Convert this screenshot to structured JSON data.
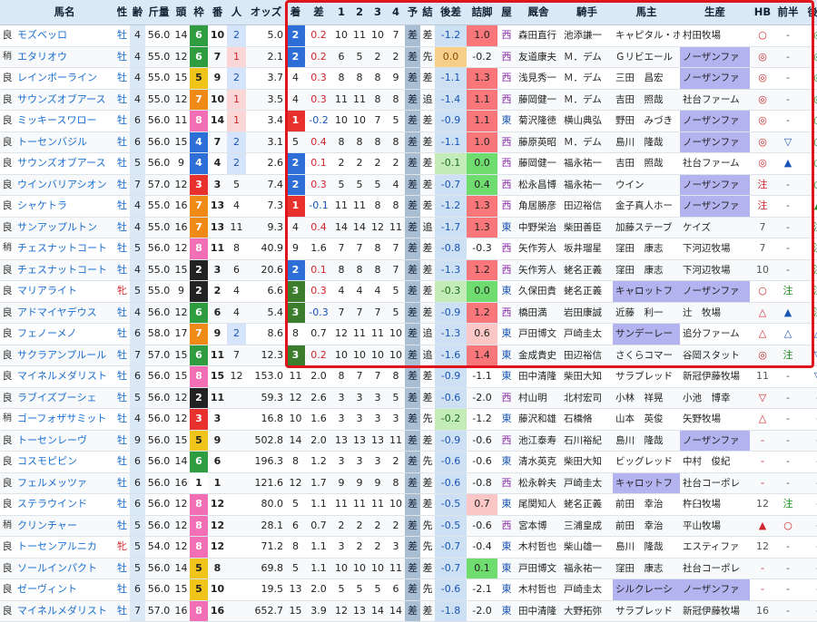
{
  "headers": [
    "",
    "馬名",
    "性",
    "齢",
    "斤量",
    "頭",
    "枠",
    "番",
    "人",
    "オッズ",
    "着",
    "差",
    "1",
    "2",
    "3",
    "4",
    "予",
    "結",
    "後差",
    "詰脚",
    "屋",
    "厩舎",
    "騎手",
    "馬主",
    "生産",
    "HB",
    "前半",
    "後半"
  ],
  "rows": [
    {
      "baba": "良",
      "name": "モズベッロ",
      "sex": "牡",
      "age": "4",
      "kin": "56.0",
      "tou": "14",
      "waku": "6",
      "uma": "10",
      "pop": "2",
      "odds": "5.0",
      "chaku": "2",
      "sa": "0.2",
      "c1": "10",
      "c2": "11",
      "c3": "10",
      "c4": "7",
      "yoso": "差",
      "kekka": "差",
      "kousa": "-1.2",
      "tsume": "1.0",
      "ya": "西",
      "kyusha": "森田直行",
      "kishu": "池添謙一",
      "owner": "キャピタル・ホ",
      "breed": "村田牧場",
      "hb": "○",
      "zen": "-",
      "kou": "◎"
    },
    {
      "baba": "稍",
      "name": "エタリオウ",
      "sex": "牡",
      "age": "4",
      "kin": "55.0",
      "tou": "12",
      "waku": "6",
      "uma": "7",
      "pop": "1",
      "odds": "2.1",
      "chaku": "2",
      "sa": "0.2",
      "c1": "6",
      "c2": "5",
      "c3": "2",
      "c4": "2",
      "yoso": "差",
      "kekka": "先",
      "kousa": "0.0",
      "tsume": "-0.2",
      "ya": "西",
      "kyusha": "友道康夫",
      "kishu": "Ｍ．デム",
      "owner": "Ｇリビエール",
      "breed": "ノーザンファ",
      "hb": "◎",
      "zen": "-",
      "kou": "◎"
    },
    {
      "baba": "良",
      "name": "レインボーライン",
      "sex": "牡",
      "age": "4",
      "kin": "55.0",
      "tou": "15",
      "waku": "5",
      "uma": "9",
      "pop": "2",
      "odds": "3.7",
      "chaku": "4",
      "sa": "0.3",
      "c1": "8",
      "c2": "8",
      "c3": "8",
      "c4": "9",
      "yoso": "差",
      "kekka": "差",
      "kousa": "-1.1",
      "tsume": "1.3",
      "ya": "西",
      "kyusha": "浅見秀一",
      "kishu": "Ｍ．デム",
      "owner": "三田　昌宏",
      "breed": "ノーザンファ",
      "hb": "◎",
      "zen": "-",
      "kou": "◎"
    },
    {
      "baba": "良",
      "name": "サウンズオブアース",
      "sex": "牡",
      "age": "4",
      "kin": "55.0",
      "tou": "12",
      "waku": "7",
      "uma": "10",
      "pop": "1",
      "odds": "3.5",
      "chaku": "4",
      "sa": "0.3",
      "c1": "11",
      "c2": "11",
      "c3": "8",
      "c4": "8",
      "yoso": "差",
      "kekka": "追",
      "kousa": "-1.4",
      "tsume": "1.1",
      "ya": "西",
      "kyusha": "藤岡健一",
      "kishu": "Ｍ．デム",
      "owner": "吉田　照哉",
      "breed": "社台ファーム",
      "hb": "◎",
      "zen": "-",
      "kou": "◎"
    },
    {
      "baba": "良",
      "name": "ミッキースワロー",
      "sex": "牡",
      "age": "6",
      "kin": "56.0",
      "tou": "11",
      "waku": "8",
      "uma": "14",
      "pop": "1",
      "odds": "3.4",
      "chaku": "1",
      "sa": "-0.2",
      "c1": "10",
      "c2": "10",
      "c3": "7",
      "c4": "5",
      "yoso": "差",
      "kekka": "差",
      "kousa": "-0.9",
      "tsume": "1.1",
      "ya": "東",
      "kyusha": "菊沢隆徳",
      "kishu": "横山典弘",
      "owner": "野田　みづき",
      "breed": "ノーザンファ",
      "hb": "◎",
      "zen": "-",
      "kou": "○"
    },
    {
      "baba": "良",
      "name": "トーセンバジル",
      "sex": "牡",
      "age": "6",
      "kin": "56.0",
      "tou": "15",
      "waku": "4",
      "uma": "7",
      "pop": "2",
      "odds": "3.1",
      "chaku": "5",
      "sa": "0.4",
      "c1": "8",
      "c2": "8",
      "c3": "8",
      "c4": "8",
      "yoso": "差",
      "kekka": "差",
      "kousa": "-1.1",
      "tsume": "1.0",
      "ya": "西",
      "kyusha": "藤原英昭",
      "kishu": "Ｍ．デム",
      "owner": "島川　隆哉",
      "breed": "ノーザンファ",
      "hb": "◎",
      "zen": "▽",
      "kou": "○"
    },
    {
      "baba": "良",
      "name": "サウンズオブアース",
      "sex": "牡",
      "age": "5",
      "kin": "56.0",
      "tou": "9",
      "waku": "4",
      "uma": "4",
      "pop": "2",
      "odds": "2.6",
      "chaku": "2",
      "sa": "0.1",
      "c1": "2",
      "c2": "2",
      "c3": "2",
      "c4": "2",
      "yoso": "差",
      "kekka": "差",
      "kousa": "-0.1",
      "tsume": "0.0",
      "ya": "西",
      "kyusha": "藤岡健一",
      "kishu": "福永祐一",
      "owner": "吉田　照哉",
      "breed": "社台ファーム",
      "hb": "◎",
      "zen": "▲",
      "kou": "○"
    },
    {
      "baba": "良",
      "name": "ウインバリアシオン",
      "sex": "牡",
      "age": "7",
      "kin": "57.0",
      "tou": "12",
      "waku": "3",
      "uma": "3",
      "pop": "5",
      "odds": "7.4",
      "chaku": "2",
      "sa": "0.3",
      "c1": "5",
      "c2": "5",
      "c3": "5",
      "c4": "4",
      "yoso": "差",
      "kekka": "差",
      "kousa": "-0.7",
      "tsume": "0.4",
      "ya": "西",
      "kyusha": "松永昌博",
      "kishu": "福永祐一",
      "owner": "ウイン",
      "breed": "ノーザンファ",
      "hb": "注",
      "zen": "-",
      "kou": "○"
    },
    {
      "baba": "良",
      "name": "シャケトラ",
      "sex": "牡",
      "age": "4",
      "kin": "55.0",
      "tou": "16",
      "waku": "7",
      "uma": "13",
      "pop": "4",
      "odds": "7.3",
      "chaku": "1",
      "sa": "-0.1",
      "c1": "11",
      "c2": "11",
      "c3": "8",
      "c4": "8",
      "yoso": "差",
      "kekka": "差",
      "kousa": "-1.2",
      "tsume": "1.3",
      "ya": "西",
      "kyusha": "角居勝彦",
      "kishu": "田辺裕信",
      "owner": "金子真人ホー",
      "breed": "ノーザンファ",
      "hb": "注",
      "zen": "-",
      "kou": "▲"
    },
    {
      "baba": "良",
      "name": "サンアップルトン",
      "sex": "牡",
      "age": "4",
      "kin": "55.0",
      "tou": "16",
      "waku": "7",
      "uma": "13",
      "pop": "11",
      "odds": "9.3",
      "chaku": "4",
      "sa": "0.4",
      "c1": "14",
      "c2": "14",
      "c3": "12",
      "c4": "11",
      "yoso": "差",
      "kekka": "追",
      "kousa": "-1.7",
      "tsume": "1.3",
      "ya": "東",
      "kyusha": "中野栄治",
      "kishu": "柴田善臣",
      "owner": "加藤ステーブ",
      "breed": "ケイズ",
      "hb": "7",
      "zen": "-",
      "kou": "注"
    },
    {
      "baba": "稍",
      "name": "チェスナットコート",
      "sex": "牡",
      "age": "5",
      "kin": "56.0",
      "tou": "12",
      "waku": "8",
      "uma": "11",
      "pop": "8",
      "odds": "40.9",
      "chaku": "9",
      "sa": "1.6",
      "c1": "7",
      "c2": "7",
      "c3": "8",
      "c4": "7",
      "yoso": "差",
      "kekka": "差",
      "kousa": "-0.8",
      "tsume": "-0.3",
      "ya": "西",
      "kyusha": "矢作芳人",
      "kishu": "坂井瑠星",
      "owner": "窪田　康志",
      "breed": "下河辺牧場",
      "hb": "7",
      "zen": "-",
      "kou": "注"
    },
    {
      "baba": "良",
      "name": "チェスナットコート",
      "sex": "牡",
      "age": "4",
      "kin": "55.0",
      "tou": "15",
      "waku": "2",
      "uma": "3",
      "pop": "6",
      "odds": "20.6",
      "chaku": "2",
      "sa": "0.1",
      "c1": "8",
      "c2": "8",
      "c3": "8",
      "c4": "7",
      "yoso": "差",
      "kekka": "差",
      "kousa": "-1.3",
      "tsume": "1.2",
      "ya": "西",
      "kyusha": "矢作芳人",
      "kishu": "蛯名正義",
      "owner": "窪田　康志",
      "breed": "下河辺牧場",
      "hb": "10",
      "zen": "-",
      "kou": "注"
    },
    {
      "baba": "良",
      "name": "マリアライト",
      "sex": "牝",
      "age": "5",
      "kin": "55.0",
      "tou": "9",
      "waku": "2",
      "uma": "2",
      "pop": "4",
      "odds": "6.6",
      "chaku": "3",
      "sa": "0.3",
      "c1": "4",
      "c2": "4",
      "c3": "4",
      "c4": "5",
      "yoso": "差",
      "kekka": "差",
      "kousa": "-0.3",
      "tsume": "0.0",
      "ya": "東",
      "kyusha": "久保田貴",
      "kishu": "蛯名正義",
      "owner": "キャロットフ",
      "breed": "ノーザンファ",
      "hb": "○",
      "zen": "注",
      "kou": "注"
    },
    {
      "baba": "良",
      "name": "アドマイヤデウス",
      "sex": "牡",
      "age": "4",
      "kin": "56.0",
      "tou": "12",
      "waku": "6",
      "uma": "6",
      "pop": "4",
      "odds": "5.4",
      "chaku": "3",
      "sa": "-0.3",
      "c1": "7",
      "c2": "7",
      "c3": "7",
      "c4": "5",
      "yoso": "差",
      "kekka": "差",
      "kousa": "-0.9",
      "tsume": "1.2",
      "ya": "西",
      "kyusha": "橋田満",
      "kishu": "岩田康誠",
      "owner": "近藤　利一",
      "breed": "辻　牧場",
      "hb": "△",
      "zen": "▲",
      "kou": "注"
    },
    {
      "baba": "良",
      "name": "フェノーメノ",
      "sex": "牡",
      "age": "6",
      "kin": "58.0",
      "tou": "17",
      "waku": "7",
      "uma": "9",
      "pop": "2",
      "odds": "8.6",
      "chaku": "8",
      "sa": "0.7",
      "c1": "12",
      "c2": "11",
      "c3": "11",
      "c4": "10",
      "yoso": "差",
      "kekka": "追",
      "kousa": "-1.3",
      "tsume": "0.6",
      "ya": "東",
      "kyusha": "戸田博文",
      "kishu": "戸崎圭太",
      "owner": "サンデーレー",
      "breed": "追分ファーム",
      "hb": "△",
      "zen": "△",
      "kou": "△"
    },
    {
      "baba": "良",
      "name": "サクラアンプルール",
      "sex": "牡",
      "age": "7",
      "kin": "57.0",
      "tou": "15",
      "waku": "6",
      "uma": "11",
      "pop": "7",
      "odds": "12.3",
      "chaku": "3",
      "sa": "0.2",
      "c1": "10",
      "c2": "10",
      "c3": "10",
      "c4": "10",
      "yoso": "差",
      "kekka": "追",
      "kousa": "-1.6",
      "tsume": "1.4",
      "ya": "東",
      "kyusha": "金成貴史",
      "kishu": "田辺裕信",
      "owner": "さくらコマー",
      "breed": "谷岡スタット",
      "hb": "◎",
      "zen": "注",
      "kou": "▽"
    },
    {
      "baba": "良",
      "name": "マイネルメダリスト",
      "sex": "牡",
      "age": "6",
      "kin": "56.0",
      "tou": "15",
      "waku": "8",
      "uma": "15",
      "pop": "12",
      "odds": "153.0",
      "chaku": "11",
      "sa": "2.0",
      "c1": "8",
      "c2": "7",
      "c3": "7",
      "c4": "8",
      "yoso": "差",
      "kekka": "差",
      "kousa": "-0.9",
      "tsume": "-1.1",
      "ya": "東",
      "kyusha": "田中清隆",
      "kishu": "柴田大知",
      "owner": "サラブレッド",
      "breed": "新冠伊藤牧場",
      "hb": "11",
      "zen": "-",
      "kou": "▽"
    },
    {
      "baba": "良",
      "name": "ラブイズブーシェ",
      "sex": "牡",
      "age": "5",
      "kin": "56.0",
      "tou": "12",
      "waku": "2",
      "uma": "11",
      "pop": "",
      "odds": "59.3",
      "chaku": "12",
      "sa": "2.6",
      "c1": "3",
      "c2": "3",
      "c3": "3",
      "c4": "5",
      "yoso": "差",
      "kekka": "差",
      "kousa": "-0.6",
      "tsume": "-2.0",
      "ya": "西",
      "kyusha": "村山明",
      "kishu": "北村宏司",
      "owner": "小林　祥晃",
      "breed": "小池　博幸",
      "hb": "▽",
      "zen": "-",
      "kou": "-"
    },
    {
      "baba": "稍",
      "name": "ゴーフォザサミット",
      "sex": "牡",
      "age": "4",
      "kin": "56.0",
      "tou": "12",
      "waku": "3",
      "uma": "3",
      "pop": "",
      "odds": "16.8",
      "chaku": "10",
      "sa": "1.6",
      "c1": "3",
      "c2": "3",
      "c3": "3",
      "c4": "3",
      "yoso": "差",
      "kekka": "先",
      "kousa": "-0.2",
      "tsume": "-1.2",
      "ya": "東",
      "kyusha": "藤沢和雄",
      "kishu": "石橋脩",
      "owner": "山本　英俊",
      "breed": "矢野牧場",
      "hb": "△",
      "zen": "-",
      "kou": "-"
    },
    {
      "baba": "良",
      "name": "トーセンレーヴ",
      "sex": "牡",
      "age": "9",
      "kin": "56.0",
      "tou": "15",
      "waku": "5",
      "uma": "9",
      "pop": "",
      "odds": "502.8",
      "chaku": "14",
      "sa": "2.0",
      "c1": "13",
      "c2": "13",
      "c3": "13",
      "c4": "11",
      "yoso": "差",
      "kekka": "差",
      "kousa": "-0.9",
      "tsume": "-0.6",
      "ya": "西",
      "kyusha": "池江泰寿",
      "kishu": "石川裕紀",
      "owner": "島川　隆哉",
      "breed": "ノーザンファ",
      "hb": "-",
      "zen": "-",
      "kou": "-"
    },
    {
      "baba": "良",
      "name": "コスモピピン",
      "sex": "牡",
      "age": "6",
      "kin": "56.0",
      "tou": "14",
      "waku": "6",
      "uma": "6",
      "pop": "",
      "odds": "196.3",
      "chaku": "8",
      "sa": "1.2",
      "c1": "3",
      "c2": "3",
      "c3": "3",
      "c4": "2",
      "yoso": "差",
      "kekka": "先",
      "kousa": "-0.6",
      "tsume": "-0.6",
      "ya": "東",
      "kyusha": "清水英克",
      "kishu": "柴田大知",
      "owner": "ビッグレッド",
      "breed": "中村　俊紀",
      "hb": "-",
      "zen": "-",
      "kou": "-"
    },
    {
      "baba": "良",
      "name": "フェルメッツァ",
      "sex": "牡",
      "age": "6",
      "kin": "56.0",
      "tou": "16",
      "waku": "1",
      "uma": "1",
      "pop": "",
      "odds": "121.6",
      "chaku": "12",
      "sa": "1.7",
      "c1": "9",
      "c2": "9",
      "c3": "9",
      "c4": "8",
      "yoso": "差",
      "kekka": "差",
      "kousa": "-0.6",
      "tsume": "-0.8",
      "ya": "西",
      "kyusha": "松永幹夫",
      "kishu": "戸崎圭太",
      "owner": "キャロットフ",
      "breed": "社台コーポレ",
      "hb": "-",
      "zen": "-",
      "kou": "-"
    },
    {
      "baba": "良",
      "name": "ステラウインド",
      "sex": "牡",
      "age": "6",
      "kin": "56.0",
      "tou": "12",
      "waku": "8",
      "uma": "12",
      "pop": "",
      "odds": "80.0",
      "chaku": "5",
      "sa": "1.1",
      "c1": "11",
      "c2": "11",
      "c3": "11",
      "c4": "10",
      "yoso": "差",
      "kekka": "差",
      "kousa": "-0.5",
      "tsume": "0.7",
      "ya": "東",
      "kyusha": "尾関知人",
      "kishu": "蛯名正義",
      "owner": "前田　幸治",
      "breed": "杵臼牧場",
      "hb": "12",
      "zen": "注",
      "kou": "-"
    },
    {
      "baba": "稍",
      "name": "クリンチャー",
      "sex": "牡",
      "age": "5",
      "kin": "56.0",
      "tou": "12",
      "waku": "8",
      "uma": "12",
      "pop": "",
      "odds": "28.1",
      "chaku": "6",
      "sa": "0.7",
      "c1": "2",
      "c2": "2",
      "c3": "2",
      "c4": "2",
      "yoso": "差",
      "kekka": "先",
      "kousa": "-0.5",
      "tsume": "-0.6",
      "ya": "西",
      "kyusha": "宮本博",
      "kishu": "三浦皇成",
      "owner": "前田　幸治",
      "breed": "平山牧場",
      "hb": "▲",
      "zen": "○",
      "kou": "-"
    },
    {
      "baba": "良",
      "name": "トーセンアルニカ",
      "sex": "牝",
      "age": "5",
      "kin": "54.0",
      "tou": "12",
      "waku": "8",
      "uma": "12",
      "pop": "",
      "odds": "71.2",
      "chaku": "8",
      "sa": "1.1",
      "c1": "3",
      "c2": "2",
      "c3": "2",
      "c4": "3",
      "yoso": "差",
      "kekka": "先",
      "kousa": "-0.7",
      "tsume": "-0.4",
      "ya": "東",
      "kyusha": "木村哲也",
      "kishu": "柴山雄一",
      "owner": "島川　隆哉",
      "breed": "エスティファ",
      "hb": "12",
      "zen": "-",
      "kou": "-"
    },
    {
      "baba": "良",
      "name": "ソールインパクト",
      "sex": "牡",
      "age": "5",
      "kin": "56.0",
      "tou": "14",
      "waku": "5",
      "uma": "8",
      "pop": "",
      "odds": "69.8",
      "chaku": "5",
      "sa": "1.1",
      "c1": "10",
      "c2": "10",
      "c3": "10",
      "c4": "11",
      "yoso": "差",
      "kekka": "差",
      "kousa": "-0.7",
      "tsume": "0.1",
      "ya": "東",
      "kyusha": "戸田博文",
      "kishu": "福永祐一",
      "owner": "窪田　康志",
      "breed": "社台コーポレ",
      "hb": "-",
      "zen": "-",
      "kou": "-"
    },
    {
      "baba": "良",
      "name": "ゼーヴィント",
      "sex": "牡",
      "age": "6",
      "kin": "56.0",
      "tou": "15",
      "waku": "5",
      "uma": "10",
      "pop": "",
      "odds": "19.5",
      "chaku": "13",
      "sa": "2.0",
      "c1": "5",
      "c2": "5",
      "c3": "5",
      "c4": "6",
      "yoso": "差",
      "kekka": "先",
      "kousa": "-0.6",
      "tsume": "-2.1",
      "ya": "東",
      "kyusha": "木村哲也",
      "kishu": "戸崎圭太",
      "owner": "シルクレーシ",
      "breed": "ノーザンファ",
      "hb": "-",
      "zen": "-",
      "kou": "-"
    },
    {
      "baba": "良",
      "name": "マイネルメダリスト",
      "sex": "牡",
      "age": "7",
      "kin": "57.0",
      "tou": "16",
      "waku": "8",
      "uma": "16",
      "pop": "",
      "odds": "652.7",
      "chaku": "15",
      "sa": "3.9",
      "c1": "12",
      "c2": "13",
      "c3": "14",
      "c4": "14",
      "yoso": "差",
      "kekka": "差",
      "kousa": "-1.8",
      "tsume": "-2.0",
      "ya": "東",
      "kyusha": "田中清隆",
      "kishu": "大野拓弥",
      "owner": "サラブレッド",
      "breed": "新冠伊藤牧場",
      "hb": "16",
      "zen": "-",
      "kou": "-"
    }
  ]
}
